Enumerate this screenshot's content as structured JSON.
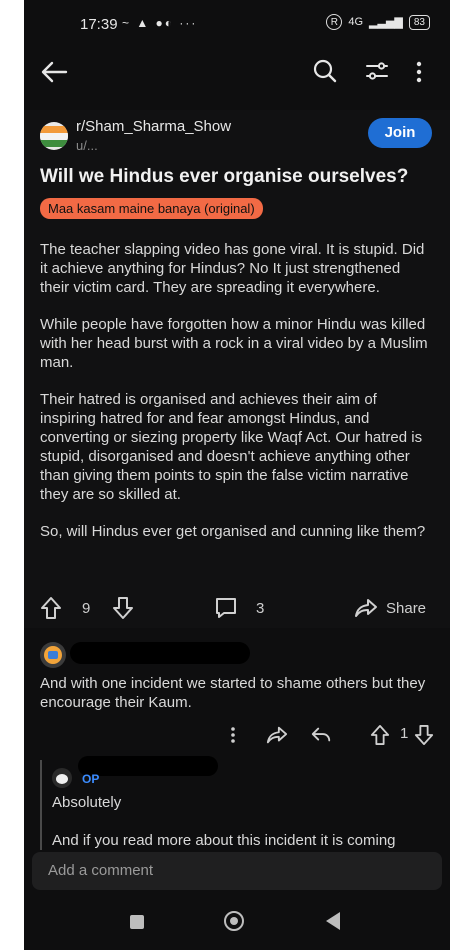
{
  "status": {
    "time": "17:39",
    "left_icons": "~ ▲ ●◐ ···",
    "right_r": "R",
    "network": "4G",
    "battery": "83"
  },
  "post": {
    "subreddit": "r/Sham_Sharma_Show",
    "user": "u/...",
    "join_label": "Join",
    "title": "Will we Hindus ever organise ourselves?",
    "flair": "Maa kasam maine banaya (original)",
    "body": [
      "The teacher slapping video has gone viral. It is stupid. Did it achieve anything for Hindus? No It just strengthened their victim card. They are spreading it everywhere.",
      "While people have forgotten how a minor Hindu was killed with her head burst with a rock in a viral video by a Muslim man.",
      "Their hatred is organised and achieves their aim of inspiring hatred for and fear amongst Hindus, and converting or siezing property like Waqf Act. Our hatred is stupid, disorganised and doesn't achieve anything other than giving them points to spin the false victim narrative they are so skilled at.",
      "So, will Hindus ever get organised and cunning like them?"
    ],
    "votes": "9",
    "comments": "3",
    "share_label": "Share"
  },
  "comment": {
    "text": "And with one incident we started to shame others but they encourage their Kaum.",
    "votes": "1"
  },
  "reply": {
    "op_label": "OP",
    "text1": "Absolutely",
    "text2": "And if you read more about this incident it is coming"
  },
  "composer": {
    "placeholder": "Add a comment"
  }
}
